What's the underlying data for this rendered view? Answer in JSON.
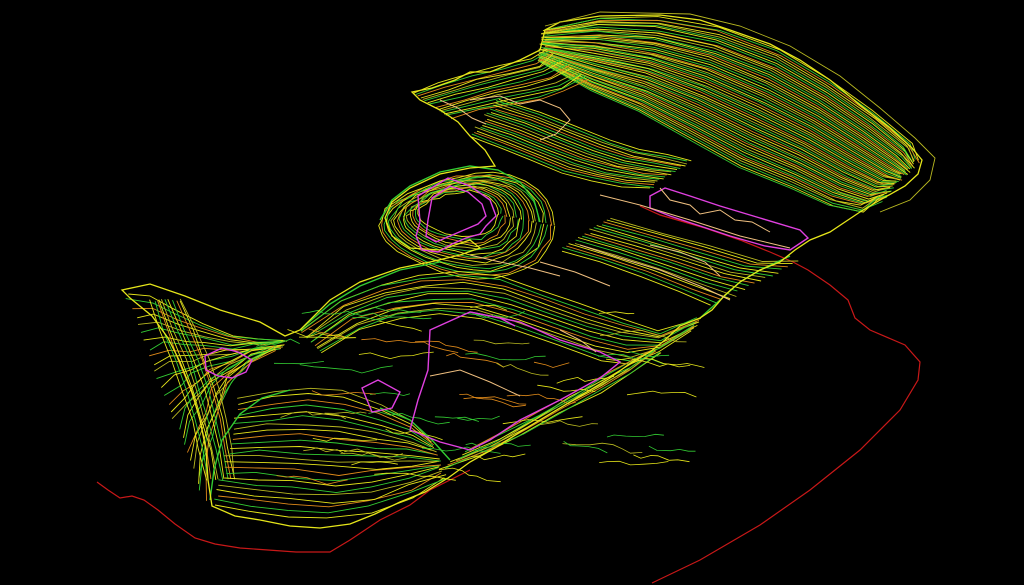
{
  "viewport": {
    "background": "#000000",
    "layer_colors": {
      "contour_yellow": "#e6e61a",
      "contour_green": "#33cc33",
      "contour_orange": "#e08a1a",
      "contour_olive": "#b8b820",
      "property_boundary": "#c81818",
      "building_outline": "#e040e0",
      "hardscape": "#f0c080"
    }
  }
}
